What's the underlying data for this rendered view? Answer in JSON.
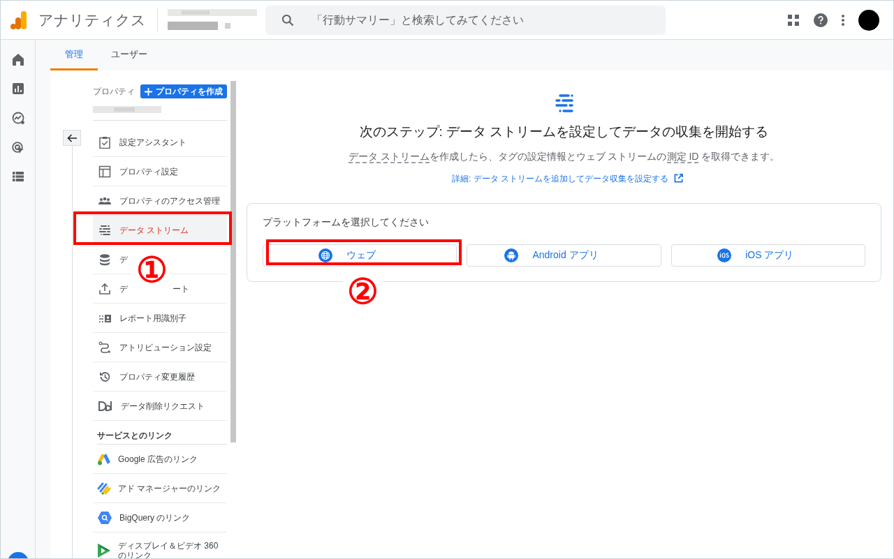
{
  "header": {
    "product_name": "アナリティクス",
    "search": {
      "placeholder": "「行動サマリー」と検索してみてください"
    }
  },
  "tabs": [
    {
      "label": "管理",
      "selected": true
    },
    {
      "label": "ユーザー",
      "selected": false
    }
  ],
  "property": {
    "label": "プロパティ",
    "create_button": "プロパティを作成"
  },
  "nav_items": [
    {
      "label": "設定アシスタント",
      "selected": false
    },
    {
      "label": "プロパティ設定",
      "selected": false
    },
    {
      "label": "プロパティのアクセス管理",
      "selected": false
    },
    {
      "label": "データ ストリーム",
      "selected": true
    },
    {
      "label": "デ",
      "selected": false
    },
    {
      "label": "デ",
      "label_tail": "ート",
      "selected": false
    },
    {
      "label": "レポート用識別子",
      "selected": false
    },
    {
      "label": "アトリビューション設定",
      "selected": false
    },
    {
      "label": "プロパティ変更履歴",
      "selected": false
    },
    {
      "label": "データ削除リクエスト",
      "selected": false
    }
  ],
  "links_section": {
    "title": "サービスとのリンク",
    "items": [
      {
        "label": "Google 広告のリンク"
      },
      {
        "label": "アド マネージャーのリンク"
      },
      {
        "label": "BigQuery のリンク"
      },
      {
        "label": "ディスプレイ＆ビデオ 360\nのリンク"
      }
    ]
  },
  "main": {
    "title": "次のステップ: データ ストリームを設定してデータの収集を開始する",
    "description": [
      {
        "text": "データ ストリーム",
        "dashed": true
      },
      {
        "text": "を作成したら、タグの設定情報とウェブ ストリームの",
        "dashed": false
      },
      {
        "text": "測定 ID",
        "dashed": true
      },
      {
        "text": " を取得できます。",
        "dashed": false
      }
    ],
    "link": "詳細: データ ストリームを追加してデータ収集を設定する"
  },
  "platform_card": {
    "title": "プラットフォームを選択してください",
    "buttons": [
      {
        "label": "ウェブ",
        "kind": "web"
      },
      {
        "label": "Android アプリ",
        "kind": "android"
      },
      {
        "label": "iOS アプリ",
        "kind": "ios"
      }
    ]
  },
  "annotations": [
    {
      "number": "①"
    },
    {
      "number": "②"
    }
  ]
}
